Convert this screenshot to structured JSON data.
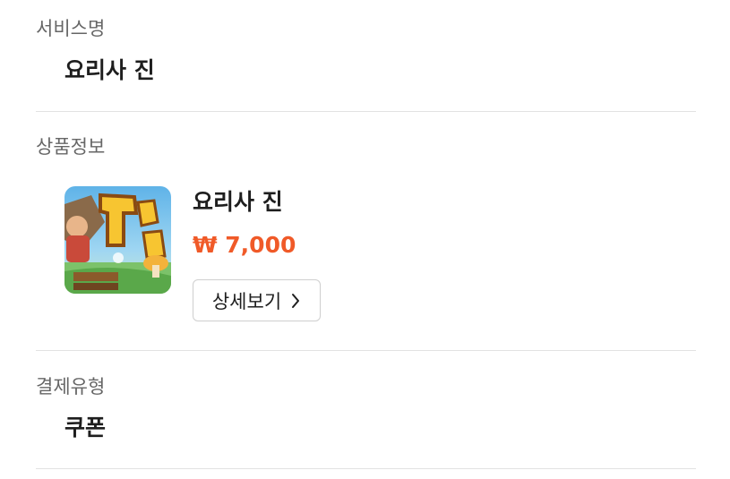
{
  "service": {
    "label": "서비스명",
    "value": "요리사 진"
  },
  "product": {
    "label": "상품정보",
    "thumbnail_icon": "game-thumbnail-image",
    "name": "요리사 진",
    "price": "₩ 7,000",
    "price_color": "#f05a28",
    "detail_button_label": "상세보기"
  },
  "payment": {
    "label": "결제유형",
    "value": "쿠폰"
  },
  "colors": {
    "divider": "#e2e2e2",
    "label": "#666666",
    "text": "#1e1e1e"
  }
}
